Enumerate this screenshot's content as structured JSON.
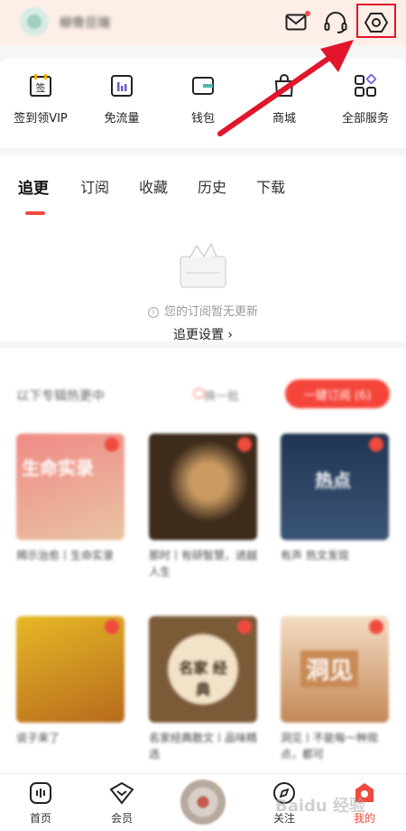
{
  "header": {
    "username": "柳骨旦瑞",
    "mail_icon": "mail-icon",
    "service_icon": "headset-icon",
    "settings_icon": "settings-hexagon-icon"
  },
  "services": [
    {
      "label": "签到领VIP",
      "icon": "sign-in-icon",
      "icon_text": "签"
    },
    {
      "label": "免流量",
      "icon": "traffic-icon"
    },
    {
      "label": "钱包",
      "icon": "wallet-icon"
    },
    {
      "label": "商城",
      "icon": "shop-icon"
    },
    {
      "label": "全部服务",
      "icon": "grid-icon"
    }
  ],
  "tabs": [
    {
      "label": "追更",
      "active": true
    },
    {
      "label": "订阅"
    },
    {
      "label": "收藏"
    },
    {
      "label": "历史"
    },
    {
      "label": "下载"
    }
  ],
  "empty_state": {
    "message": "您的订阅暂无更新",
    "link": "追更设置 ›"
  },
  "recommend": {
    "title": "以下专辑热更中",
    "refresh": "换一批",
    "subscribe_all": "一键订阅 (6)",
    "cards": [
      {
        "title": "揭示治愈丨生命实录",
        "cover_text": "生命实录",
        "colors": [
          "#f08a86",
          "#e9c3a4"
        ]
      },
      {
        "title": "那时丨有研智慧，进越人生",
        "colors": [
          "#3d2b1c",
          "#b9875a"
        ]
      },
      {
        "title": "有声 热文发现",
        "cover_text": "热点",
        "colors": [
          "#1f3552",
          "#3c5678"
        ]
      },
      {
        "title": "说子来了",
        "colors": [
          "#e7b826",
          "#b76a1d"
        ]
      },
      {
        "title": "名家经典散文丨品味精选",
        "cover_text": "名家 经典",
        "colors": [
          "#f1e2c8",
          "#7b5a38"
        ]
      },
      {
        "title": "洞见丨不能每一种观点，都可",
        "cover_text": "洞见",
        "colors": [
          "#f3ddc4",
          "#c48856"
        ]
      }
    ]
  },
  "bottom_nav": [
    {
      "label": "首页",
      "icon": "home-icon"
    },
    {
      "label": "会员",
      "icon": "vip-diamond-icon"
    },
    {
      "label": "",
      "icon": "player-disc-icon"
    },
    {
      "label": "关注",
      "icon": "follow-icon"
    },
    {
      "label": "我的",
      "icon": "profile-icon",
      "active": true
    }
  ],
  "watermark": "Baidu 经验",
  "colors": {
    "accent": "#f04a3e",
    "highlight_box": "#e1152b",
    "header_bg": "#fdeee8"
  }
}
